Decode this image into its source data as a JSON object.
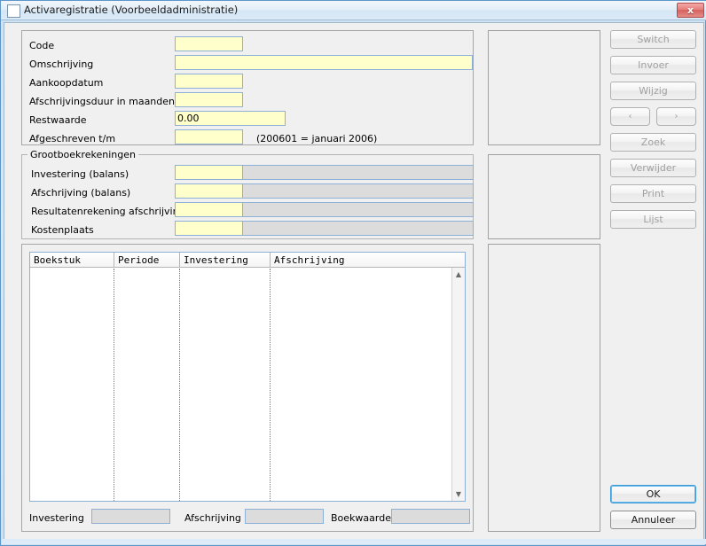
{
  "window": {
    "title": "Activaregistratie (Voorbeeldadministratie)",
    "close_label": "x",
    "icon": "window-icon"
  },
  "colors": {
    "input_bg": "#ffffcc",
    "input_border": "#8fb0d6",
    "readonly_bg": "#dcdcdc",
    "window_bg": "#f0f0f0",
    "titlebar": "#dbeaf7",
    "close_red": "#d6615e",
    "default_focus": "#3c9ad6"
  },
  "form": {
    "fields": [
      {
        "label": "Code",
        "value": "",
        "placeholder": ""
      },
      {
        "label": "Omschrijving",
        "value": "",
        "placeholder": ""
      },
      {
        "label": "Aankoopdatum",
        "value": "",
        "placeholder": ""
      },
      {
        "label": "Afschrijvingsduur in maanden",
        "value": "",
        "placeholder": ""
      },
      {
        "label": "Restwaarde",
        "value": "0.00",
        "placeholder": ""
      },
      {
        "label": "Afgeschreven t/m",
        "value": "",
        "placeholder": ""
      }
    ],
    "period_hint": "(200601 = januari 2006)"
  },
  "ledger": {
    "legend": "Grootboekrekeningen",
    "rows": [
      {
        "label": "Investering (balans)",
        "code": "",
        "description": ""
      },
      {
        "label": "Afschrijving (balans)",
        "code": "",
        "description": ""
      },
      {
        "label": "Resultatenrekening afschrijving",
        "code": "",
        "description": ""
      },
      {
        "label": "Kostenplaats",
        "code": "",
        "description": ""
      }
    ]
  },
  "grid": {
    "columns": [
      "Boekstuk",
      "Periode",
      "Investering",
      "Afschrijving"
    ],
    "rows": [],
    "scroll_up": "▲",
    "scroll_down": "▼"
  },
  "summary": [
    {
      "label": "Investering",
      "value": ""
    },
    {
      "label": "Afschrijving",
      "value": ""
    },
    {
      "label": "Boekwaarde",
      "value": ""
    }
  ],
  "sidebar": {
    "buttons": [
      {
        "label": "Switch",
        "enabled": false
      },
      {
        "label": "Invoer",
        "enabled": false
      },
      {
        "label": "Wijzig",
        "enabled": false
      },
      {
        "label": "‹",
        "enabled": false
      },
      {
        "label": "›",
        "enabled": false
      },
      {
        "label": "Zoek",
        "enabled": false
      },
      {
        "label": "Verwijder",
        "enabled": false
      },
      {
        "label": "Print",
        "enabled": false
      },
      {
        "label": "Lijst",
        "enabled": false
      }
    ],
    "ok_label": "OK",
    "cancel_label": "Annuleer"
  }
}
